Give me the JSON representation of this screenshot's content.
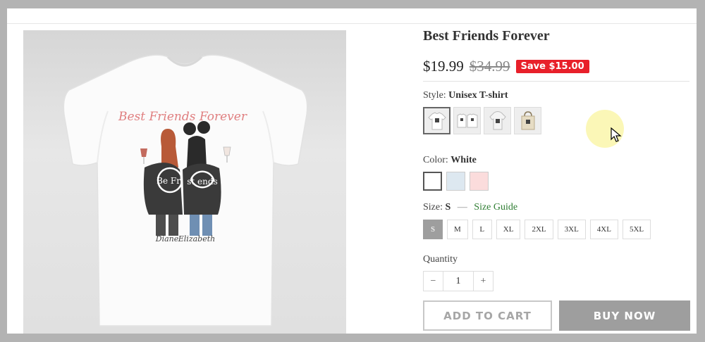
{
  "product": {
    "title": "Best Friends Forever",
    "price": "$19.99",
    "compare_price": "$34.99",
    "save_badge": "Save $15.00"
  },
  "image": {
    "shirt_heading": "Best Friends Forever",
    "name_left": "Diane",
    "name_right": "Elizabeth",
    "jacket_left": "Be Fri",
    "jacket_right": "st ends"
  },
  "style": {
    "label": "Style:",
    "selected": "Unisex T-shirt",
    "thumbs": [
      "t-shirt-icon",
      "t-shirt-pair-icon",
      "hoodie-icon",
      "tote-bag-icon"
    ]
  },
  "color": {
    "label": "Color:",
    "selected": "White",
    "swatches": [
      "#ffffff",
      "#dde8f0",
      "#fbdcdc"
    ]
  },
  "size": {
    "label": "Size:",
    "selected": "S",
    "separator": "—",
    "guide": "Size Guide",
    "options": [
      "S",
      "M",
      "L",
      "XL",
      "2XL",
      "3XL",
      "4XL",
      "5XL"
    ]
  },
  "quantity": {
    "label": "Quantity",
    "minus": "−",
    "value": "1",
    "plus": "+"
  },
  "actions": {
    "add_to_cart": "ADD TO CART",
    "buy_now": "BUY NOW"
  },
  "colors": {
    "save_badge": "#e8202a",
    "size_guide": "#2e7d32",
    "buy_now": "#9e9e9e"
  }
}
